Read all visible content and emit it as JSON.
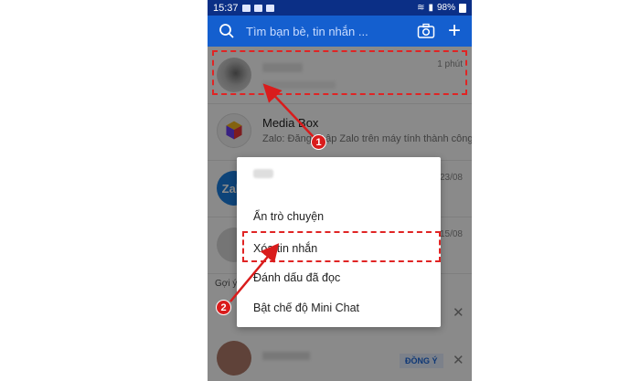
{
  "status_bar": {
    "time": "15:37",
    "battery": "98%"
  },
  "header": {
    "search_placeholder": "Tìm bạn bè, tin nhắn ..."
  },
  "chats": [
    {
      "time": "1 phút"
    },
    {
      "name": "Media Box",
      "preview": "Zalo: Đăng nhập Zalo trên máy tính thành công"
    },
    {
      "time": "23/08"
    },
    {
      "time": "15/08"
    }
  ],
  "suggestion": {
    "label": "Gợi ý",
    "agree_label": "ĐỒNG Ý"
  },
  "context_menu": {
    "items": [
      "Ẩn trò chuyện",
      "Xóa tin nhắn",
      "Đánh dấu đã đọc",
      "Bật chế độ Mini Chat"
    ]
  },
  "steps": [
    "1",
    "2"
  ],
  "colors": {
    "header": "#145fcf",
    "status_bar": "#0b2f86",
    "highlight": "#e02424"
  }
}
